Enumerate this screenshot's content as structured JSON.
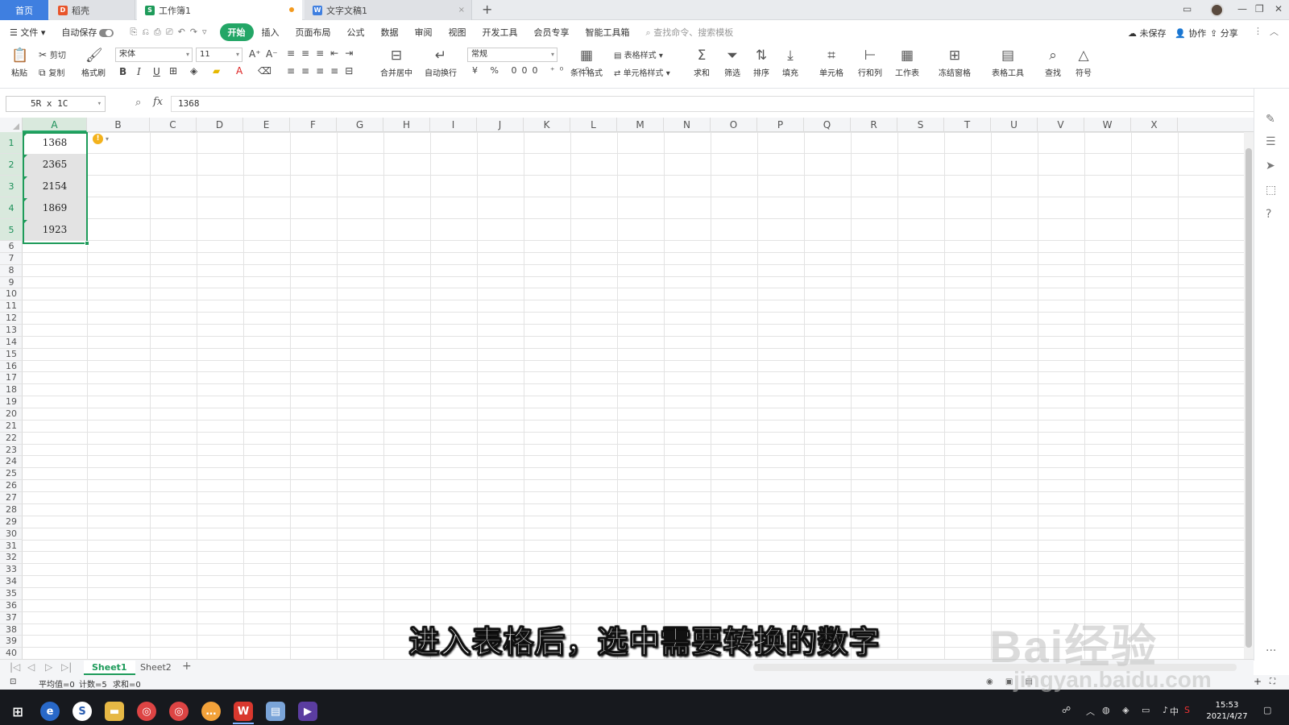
{
  "tabs": {
    "home": "首页",
    "docs": [
      {
        "label": "稻壳",
        "icon_color": "#e8542a",
        "icon_letter": "D"
      },
      {
        "label": "工作簿1",
        "icon_color": "#1e9b5a",
        "icon_letter": "S"
      },
      {
        "label": "文字文稿1",
        "icon_color": "#3f7fe0",
        "icon_letter": "W"
      }
    ],
    "new_tab": "+"
  },
  "menu": {
    "file": "文件",
    "autosave": "自动保存",
    "items": [
      "开始",
      "插入",
      "页面布局",
      "公式",
      "数据",
      "审阅",
      "视图",
      "开发工具",
      "会员专享",
      "智能工具箱"
    ],
    "active": "开始",
    "search_placeholder": "查找命令、搜索模板",
    "unsaved": "未保存",
    "collab": "协作",
    "share": "分享"
  },
  "ribbon": {
    "paste": "粘贴",
    "cut": "剪切",
    "copy": "复制",
    "format_painter": "格式刷",
    "font_name": "宋体",
    "font_size": "11",
    "merge_center": "合并居中",
    "wrap_text": "自动换行",
    "number_format": "常规",
    "table_style": "表格样式",
    "cell_style": "单元格样式",
    "cond_format": "条件格式",
    "sum": "求和",
    "filter": "筛选",
    "sort": "排序",
    "fill": "填充",
    "cells": "单元格",
    "rowcol": "行和列",
    "worksheet": "工作表",
    "freeze": "冻结窗格",
    "table_tools": "表格工具",
    "find": "查找",
    "symbol": "符号"
  },
  "formula": {
    "name_box": "5R x 1C",
    "fx": "fx",
    "value": "1368"
  },
  "grid": {
    "columns": [
      "A",
      "B",
      "C",
      "D",
      "E",
      "F",
      "G",
      "H",
      "I",
      "J",
      "K",
      "L",
      "M",
      "N",
      "O",
      "P",
      "Q",
      "R",
      "S",
      "T",
      "U",
      "V",
      "W",
      "X"
    ],
    "rows": [
      "1",
      "2",
      "3",
      "4",
      "5",
      "6",
      "7",
      "8",
      "9",
      "10",
      "11",
      "12",
      "13",
      "14",
      "15",
      "16",
      "17",
      "18",
      "19",
      "20",
      "21",
      "22",
      "23",
      "24",
      "25",
      "26",
      "27",
      "28",
      "29",
      "30",
      "31",
      "32",
      "33",
      "34",
      "35",
      "36",
      "37",
      "38",
      "39",
      "40"
    ],
    "values": [
      "1368",
      "2365",
      "2154",
      "1869",
      "1923"
    ],
    "selected_col": "A"
  },
  "sheets": {
    "tabs": [
      "Sheet1",
      "Sheet2"
    ],
    "active": "Sheet1",
    "add": "+"
  },
  "status": {
    "average": "平均值=0",
    "count": "计数=5",
    "sum": "求和=0"
  },
  "taskbar": {
    "time": "15:53",
    "date": "2021/4/27",
    "ime": "中"
  },
  "overlay": {
    "subtitle": "进入表格后，选中需要转换的数字",
    "watermark_brand": "Bai经验",
    "watermark_url": "jingyan.baidu.com"
  }
}
